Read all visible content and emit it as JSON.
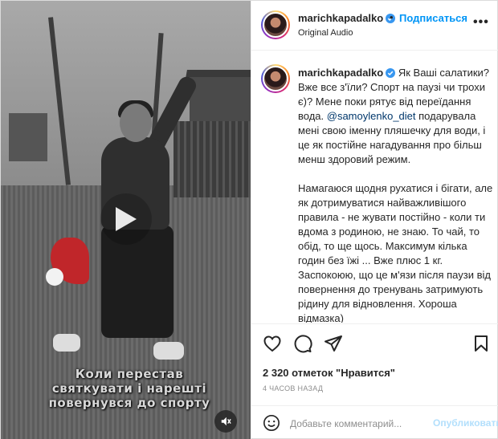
{
  "post": {
    "author": {
      "username": "marichkapadalko",
      "verified": true
    },
    "header": {
      "follow_label": "Подписаться",
      "separator": "•",
      "audio_label": "Original Audio",
      "more_label": "•••"
    },
    "media": {
      "type": "video",
      "caption_lines": [
        "Коли перестав",
        "святкувати і нарешті",
        "повернувся до спорту"
      ]
    },
    "comment": {
      "username": "marichkapadalko",
      "text_before_mention": "Як Ваші салатики? Вже все з'їли? Спорт на паузі чи трохи є)? Мене поки рятує від переїдання вода. ",
      "mention": "@samoylenko_diet",
      "text_after_mention": " подарувала мені свою іменну пляшечку для води, і це як постійне нагадування про більш менш здоровий режим.",
      "paragraph_2": "Намагаюся щодня рухатися і бігати, але як дотримуватися найважливішого правила - не жувати постійно - коли ти вдома з родиною, не знаю. То чай, то обід, то ще щось. Максимум кілька годин без їжі ... Вже плюс 1 кг. Заспокоюю, що це м'язи після паузи від повернення до тренувань затримують рідину для відновлення. Хороша відмазка)"
    },
    "likes_text": "2 320 отметок \"Нравится\"",
    "timestamp": "4 ЧАСОВ НАЗАД",
    "add_comment": {
      "placeholder": "Добавьте комментарий...",
      "publish_label": "Опубликовать"
    },
    "colors": {
      "accent": "#0095f6",
      "publish_disabled": "#b2dffc",
      "mention": "#00376b",
      "muted": "#8e8e8e"
    },
    "icons": [
      "verified-icon",
      "more-icon",
      "play-icon",
      "audio-muted-icon",
      "heart-icon",
      "comment-icon",
      "share-icon",
      "bookmark-icon",
      "emoji-icon"
    ]
  }
}
